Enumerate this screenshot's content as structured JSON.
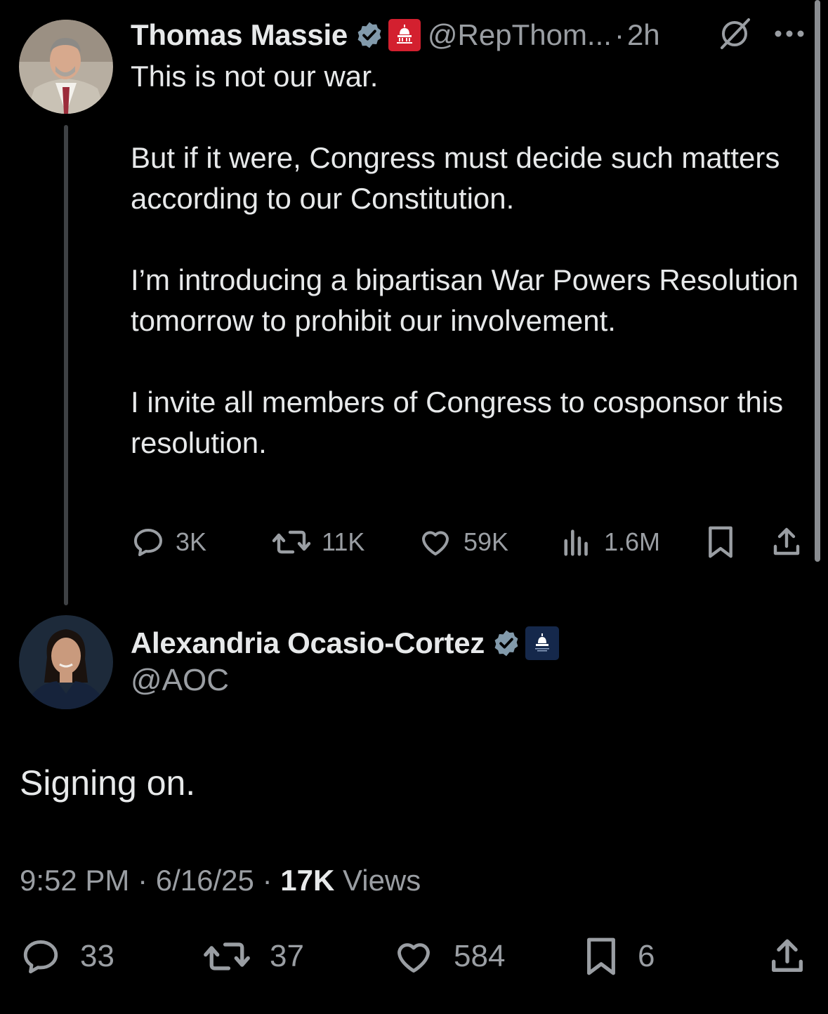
{
  "parent_tweet": {
    "author_name": "Thomas Massie",
    "handle": "@RepThom...",
    "separator": "·",
    "time": "2h",
    "paragraphs": [
      "This is not our war.",
      "But if it were, Congress must decide such matters according to our Constitution.",
      "I’m introducing a bipartisan War Powers Resolution tomorrow to prohibit our involvement.",
      "I invite all members of Congress to cosponsor this resolution."
    ],
    "actions": {
      "replies": "3K",
      "reposts": "11K",
      "likes": "59K",
      "views": "1.6M"
    },
    "icons": [
      "verified-icon",
      "gop-capitol-badge-icon",
      "grok-icon",
      "more-icon",
      "reply-icon",
      "repost-icon",
      "like-icon",
      "views-icon",
      "bookmark-icon",
      "share-icon"
    ]
  },
  "reply_tweet": {
    "author_name": "Alexandria Ocasio-Cortez",
    "handle": "@AOC",
    "text": "Signing on.",
    "meta": {
      "time": "9:52 PM",
      "date": "6/16/25",
      "separator": "·",
      "views_count": "17K",
      "views_label": "Views"
    },
    "actions": {
      "replies": "33",
      "reposts": "37",
      "likes": "584",
      "bookmarks": "6"
    },
    "icons": [
      "verified-icon",
      "house-democrats-badge-icon",
      "reply-icon",
      "repost-icon",
      "like-icon",
      "bookmark-icon",
      "share-icon"
    ]
  },
  "colors": {
    "background": "#000000",
    "text": "#e7e9ea",
    "secondary": "#9a9ea3",
    "verified": "#829aab",
    "gop_badge": "#d3202f",
    "dem_badge": "#15284b",
    "thread_line": "#3e4144"
  }
}
